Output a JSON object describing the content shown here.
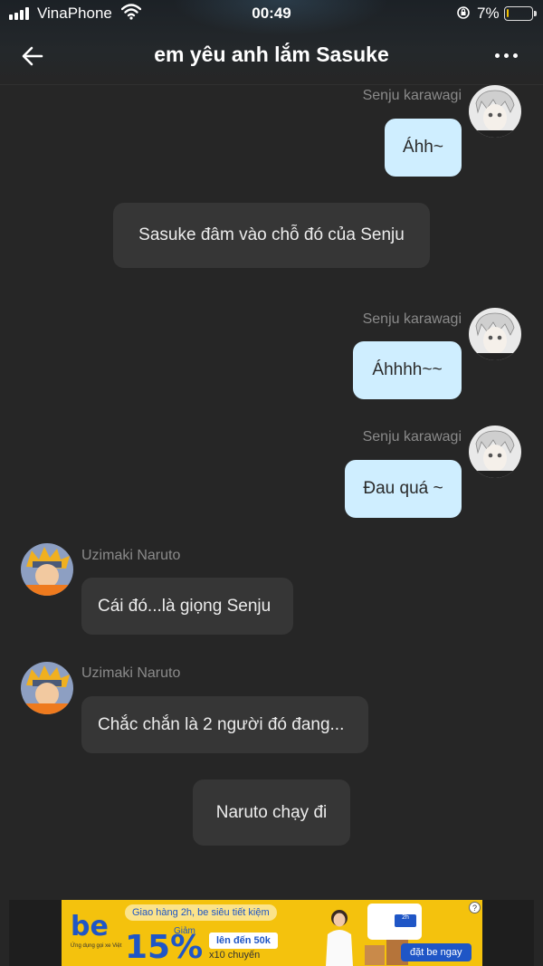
{
  "status_bar": {
    "carrier": "VinaPhone",
    "time": "00:49",
    "battery_percent": "7%",
    "battery_level": 0.07,
    "icons": [
      "signal-icon",
      "wifi-icon",
      "orientation-lock-icon",
      "battery-icon"
    ]
  },
  "header": {
    "title": "em yêu anh lắm Sasuke",
    "back_icon": "arrow-left-icon",
    "more_icon": "ellipsis-icon"
  },
  "messages": [
    {
      "type": "outgoing",
      "sender": "Senju karawagi",
      "text": "Áhh~"
    },
    {
      "type": "narration",
      "text": "Sasuke đâm vào chỗ đó của Senju"
    },
    {
      "type": "outgoing",
      "sender": "Senju karawagi",
      "text": "Áhhhh~~"
    },
    {
      "type": "outgoing",
      "sender": "Senju karawagi",
      "text": "Đau quá ~"
    },
    {
      "type": "incoming",
      "sender": "Uzimaki Naruto",
      "text": "Cái đó...là giọng Senju"
    },
    {
      "type": "incoming",
      "sender": "Uzimaki Naruto",
      "text": "Chắc chắn là 2 người đó đang..."
    },
    {
      "type": "narration",
      "text": "Naruto chạy đi"
    }
  ],
  "ad": {
    "brand": "be",
    "brand_sub": "Ứng dụng gọi xe Việt",
    "promo": "Giao hàng 2h, be siêu tiết kiệm",
    "discount_label": "Giảm",
    "discount": "15%",
    "up_to": "lên đến 50k",
    "trips": "x10 chuyến",
    "phone_chip": "2h",
    "cta": "đặt be ngay",
    "help": "?",
    "colors": {
      "background": "#f4c20d",
      "brand": "#1f56c6"
    }
  },
  "colors": {
    "background": "#262626",
    "outgoing_bubble": "#cfeeff",
    "incoming_bubble": "#363636",
    "sender_name": "#8a8a8a"
  }
}
